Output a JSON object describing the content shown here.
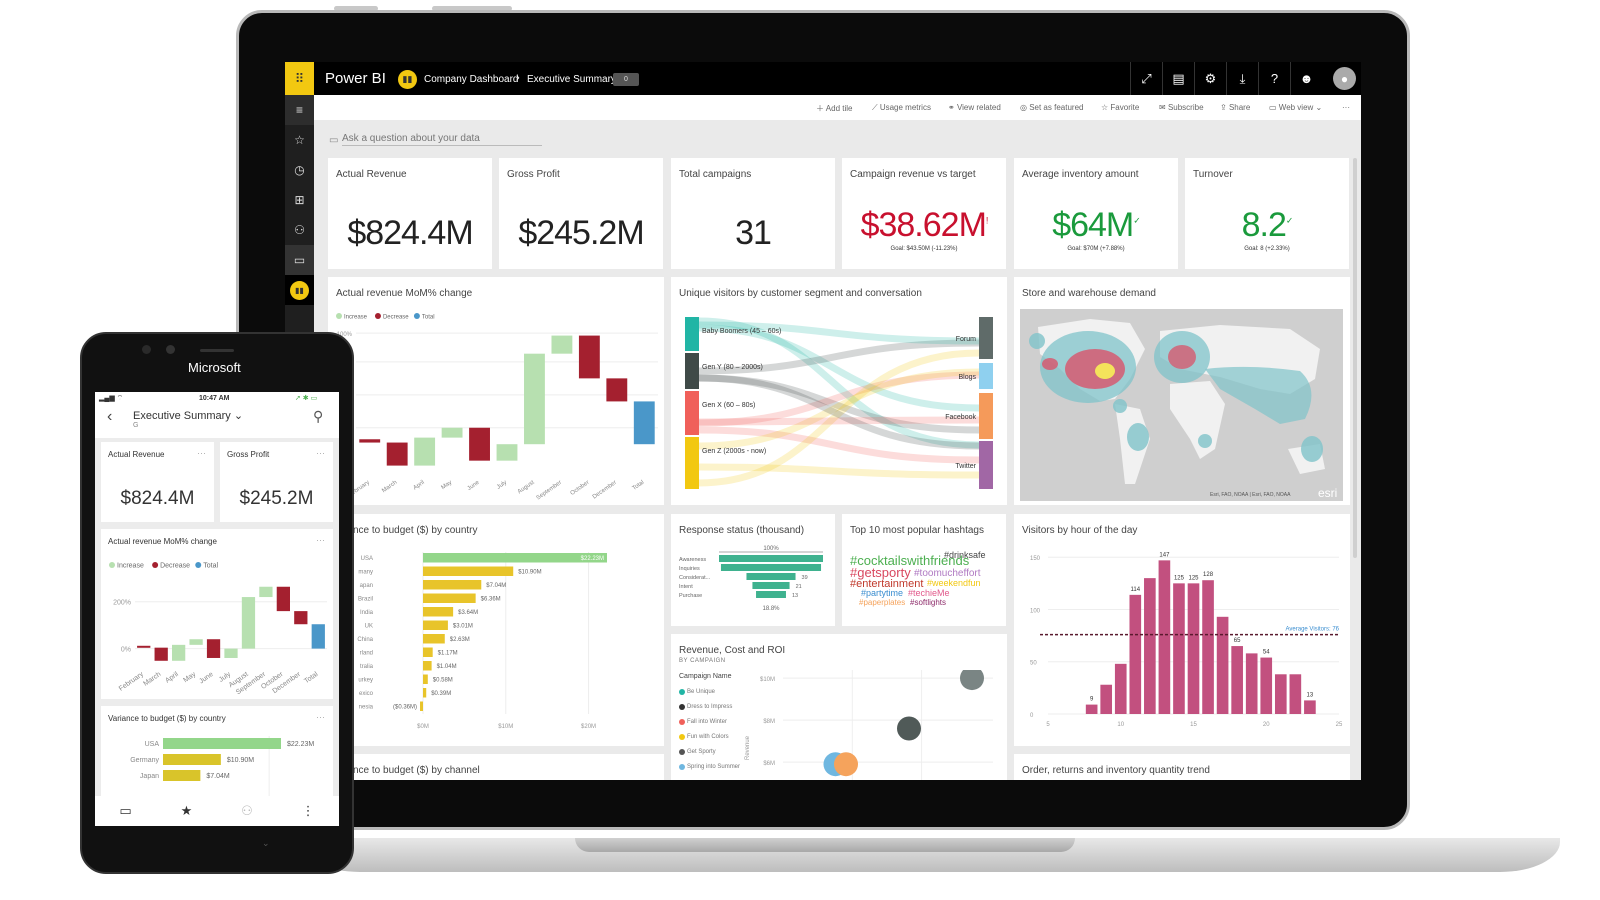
{
  "app": {
    "name": "Power BI",
    "workspace": "Company Dashboard",
    "report": "Executive Summary",
    "badge": "0"
  },
  "topbar_icons": [
    "expand-icon",
    "comment-icon",
    "gear-icon",
    "download-icon",
    "help-icon",
    "smiley-icon",
    "user-avatar-icon"
  ],
  "leftnav": [
    "hamburger-icon",
    "favorites-star-icon",
    "recent-clock-icon",
    "apps-icon",
    "shared-people-icon",
    "workspaces-icon",
    "workspace-powerbi-icon"
  ],
  "actions": {
    "add_tile": "Add tile",
    "usage_metrics": "Usage metrics",
    "view_related": "View related",
    "set_featured": "Set as featured",
    "favorite": "Favorite",
    "subscribe": "Subscribe",
    "share": "Share",
    "web_view": "Web view"
  },
  "qna": {
    "placeholder": "Ask a question about your data"
  },
  "kpis": [
    {
      "title": "Actual Revenue",
      "value": "$824.4M"
    },
    {
      "title": "Gross Profit",
      "value": "$245.2M"
    },
    {
      "title": "Total campaigns",
      "value": "31"
    },
    {
      "title": "Campaign revenue vs target",
      "value": "$38.62M",
      "status": "!",
      "goal": "Goal: $43.50M (-11.23%)",
      "color": "#c8102e"
    },
    {
      "title": "Average inventory amount",
      "value": "$64M",
      "status": "✓",
      "goal": "Goal: $70M (+7.88%)",
      "color": "#1a9a3c"
    },
    {
      "title": "Turnover",
      "value": "8.2",
      "status": "✓",
      "goal": "Goal: 8 (+2.33%)",
      "color": "#1a9a3c"
    }
  ],
  "waterfall": {
    "title": "Actual revenue MoM% change",
    "legend": [
      "Increase",
      "Decrease",
      "Total"
    ],
    "colors": {
      "increase": "#b7e0b0",
      "decrease": "#a4202f",
      "total": "#4a97c9"
    },
    "ytick": "100%",
    "categories": [
      "February",
      "March",
      "April",
      "May",
      "June",
      "July",
      "August",
      "September",
      "October",
      "December",
      "Total"
    ],
    "steps": [
      {
        "from": 0.06,
        "to": 0.02,
        "t": "d"
      },
      {
        "from": 0.02,
        "to": -0.26,
        "t": "d"
      },
      {
        "from": -0.26,
        "to": 0.08,
        "t": "i"
      },
      {
        "from": 0.08,
        "to": 0.2,
        "t": "i"
      },
      {
        "from": 0.2,
        "to": -0.2,
        "t": "d"
      },
      {
        "from": -0.2,
        "to": 0.0,
        "t": "i"
      },
      {
        "from": 0.0,
        "to": 1.1,
        "t": "i"
      },
      {
        "from": 1.1,
        "to": 1.32,
        "t": "i"
      },
      {
        "from": 1.32,
        "to": 0.8,
        "t": "d"
      },
      {
        "from": 0.8,
        "to": 0.52,
        "t": "d"
      },
      {
        "from": 0,
        "to": 0.52,
        "t": "t"
      }
    ]
  },
  "sankey": {
    "title": "Unique visitors by customer segment and conversation",
    "sources": [
      {
        "label": "Baby Boomers (45 – 60s)",
        "color": "#21b5a5"
      },
      {
        "label": "Gen Y (80 – 2000s)",
        "color": "#3f4a48"
      },
      {
        "label": "Gen X (60 – 80s)",
        "color": "#f0605a"
      },
      {
        "label": "Gen Z (2000s - now)",
        "color": "#f2c811"
      }
    ],
    "targets": [
      {
        "label": "Forum",
        "color": "#5f6b69"
      },
      {
        "label": "Blogs",
        "color": "#8fd0ef"
      },
      {
        "label": "Facebook",
        "color": "#f59a5a"
      },
      {
        "label": "Twitter",
        "color": "#a167a5"
      }
    ]
  },
  "map": {
    "title": "Store and warehouse demand",
    "attribution": "Esri, FAO, NOAA | Esri, FAO, NOAA",
    "logo": "esri"
  },
  "variance_country": {
    "title": "Variance to budget ($) by country",
    "title_visible": "nce to budget ($) by country",
    "categories": [
      "USA",
      "Germany",
      "Japan",
      "Brazil",
      "India",
      "UK",
      "China",
      "Holland",
      "Australia",
      "Turkey",
      "Mexico",
      "Indonesia"
    ],
    "categories_visible": [
      "USA",
      "many",
      "apan",
      "Brazil",
      "India",
      "UK",
      "China",
      "rland",
      "tralia",
      "urkey",
      "exico",
      "nesia"
    ],
    "values": [
      22.23,
      10.9,
      7.04,
      6.36,
      3.64,
      3.01,
      2.63,
      1.17,
      1.04,
      0.58,
      0.39,
      -0.36
    ],
    "labels": [
      "$22.23M",
      "$10.90M",
      "$7.04M",
      "$6.36M",
      "$3.64M",
      "$3.01M",
      "$2.63M",
      "$1.17M",
      "$1.04M",
      "$0.58M",
      "$0.39M",
      "($0.36M)"
    ],
    "xticks": [
      "$0M",
      "$10M",
      "$20M"
    ],
    "highlight_color": "#93d68a",
    "bar_color": "#e8c42a"
  },
  "variance_channel": {
    "title_visible": "nce to budget ($) by channel"
  },
  "funnel": {
    "title": "Response status (thousand)",
    "top_pct": "100%",
    "bottom_pct": "18.8%",
    "stages": [
      "Awareness",
      "Inquiries",
      "Considerat...",
      "Intent",
      "Purchase"
    ],
    "values": [
      207,
      190,
      39,
      21,
      13
    ],
    "shown_labels": [
      "",
      "",
      "39",
      "21",
      "13"
    ],
    "color": "#3fb28f"
  },
  "hashtags": {
    "title": "Top 10 most popular hashtags",
    "words": [
      {
        "t": "#cocktailswithfriends",
        "c": "#4caf50"
      },
      {
        "t": "#drinksafe",
        "c": "#444"
      },
      {
        "t": "#getsporty",
        "c": "#d9475f"
      },
      {
        "t": "#toomucheffort",
        "c": "#b07ac2"
      },
      {
        "t": "#entertainment",
        "c": "#c0392b"
      },
      {
        "t": "#weekendfun",
        "c": "#f2c811"
      },
      {
        "t": "#partytime",
        "c": "#3b8ed0"
      },
      {
        "t": "#techieMe",
        "c": "#e25a8c"
      },
      {
        "t": "#paperplates",
        "c": "#f5a35c"
      },
      {
        "t": "#softlights",
        "c": "#8e2d6b"
      }
    ]
  },
  "scatter": {
    "title": "Revenue, Cost and ROI",
    "subtitle": "BY CAMPAIGN",
    "legend_title": "Campaign Name",
    "campaigns": [
      {
        "name": "Be Unique",
        "color": "#21b5a5"
      },
      {
        "name": "Dress to Impress",
        "color": "#333"
      },
      {
        "name": "Fall into Winter",
        "color": "#f0605a"
      },
      {
        "name": "Fun with Colors",
        "color": "#f2c811"
      },
      {
        "name": "Get Sporty",
        "color": "#555"
      },
      {
        "name": "Spring into Summer",
        "color": "#6fb7e0"
      }
    ],
    "yticks": [
      "$10M",
      "$8M",
      "$6M"
    ],
    "ylabel": "Revenue",
    "points": [
      {
        "x": 0.9,
        "y": 10.0,
        "color": "#7a8584"
      },
      {
        "x": 0.6,
        "y": 7.6,
        "color": "#505a58"
      },
      {
        "x": 0.25,
        "y": 5.9,
        "color": "#6fb7e0"
      },
      {
        "x": 0.3,
        "y": 5.9,
        "color": "#f5a35c"
      }
    ]
  },
  "visitors": {
    "title": "Visitors by hour of the day",
    "yticks": [
      0,
      50,
      100,
      150
    ],
    "xticks": [
      5,
      10,
      15,
      20,
      25
    ],
    "hours": [
      8,
      9,
      10,
      11,
      12,
      13,
      14,
      15,
      16,
      17,
      18,
      19,
      20,
      21,
      22,
      23
    ],
    "values": [
      9,
      28,
      48,
      114,
      130,
      147,
      125,
      125,
      128,
      93,
      65,
      58,
      54,
      38,
      38,
      13
    ],
    "labeled": [
      9,
      114,
      147,
      125,
      128,
      65,
      54,
      13
    ],
    "average": 76,
    "average_label": "Average Visitors: 76",
    "color": "#c2507f"
  },
  "order_trend": {
    "title": "Order, returns and inventory quantity trend"
  },
  "phone": {
    "brand": "Microsoft",
    "time": "10:47 AM",
    "title": "Executive Summary",
    "subtitle": "G",
    "kpis": [
      {
        "title": "Actual Revenue",
        "value": "$824.4M"
      },
      {
        "title": "Gross Profit",
        "value": "$245.2M"
      }
    ],
    "waterfall_title": "Actual revenue MoM% change",
    "waterfall_yticks": [
      "200%",
      "0%"
    ],
    "variance_title": "Variance to budget ($) by country",
    "variance": [
      {
        "c": "USA",
        "v": 22.23,
        "l": "$22.23M"
      },
      {
        "c": "Germany",
        "v": 10.9,
        "l": "$10.90M"
      },
      {
        "c": "Japan",
        "v": 7.04,
        "l": "$7.04M"
      }
    ],
    "bottom_nav": [
      "chat-icon",
      "star-icon",
      "person-icon",
      "more-icon"
    ]
  }
}
